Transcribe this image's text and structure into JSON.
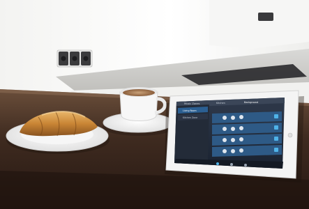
{
  "scene": {
    "description_objects": [
      "wall",
      "socket",
      "countertop",
      "plate",
      "croissant",
      "coffee-cup",
      "tablet"
    ]
  },
  "tablet": {
    "sidebar_header": "Music Zones",
    "sidebar_items": [
      "Living Room",
      "Kitchen Zone"
    ],
    "top_tab": "Kitchen",
    "top_title": "Background",
    "colors": {
      "bezel": "#f4f4f4",
      "screen_dark": "#1d2430",
      "screen_blue": "#2b5f92",
      "accent": "#4fb3e8"
    }
  }
}
